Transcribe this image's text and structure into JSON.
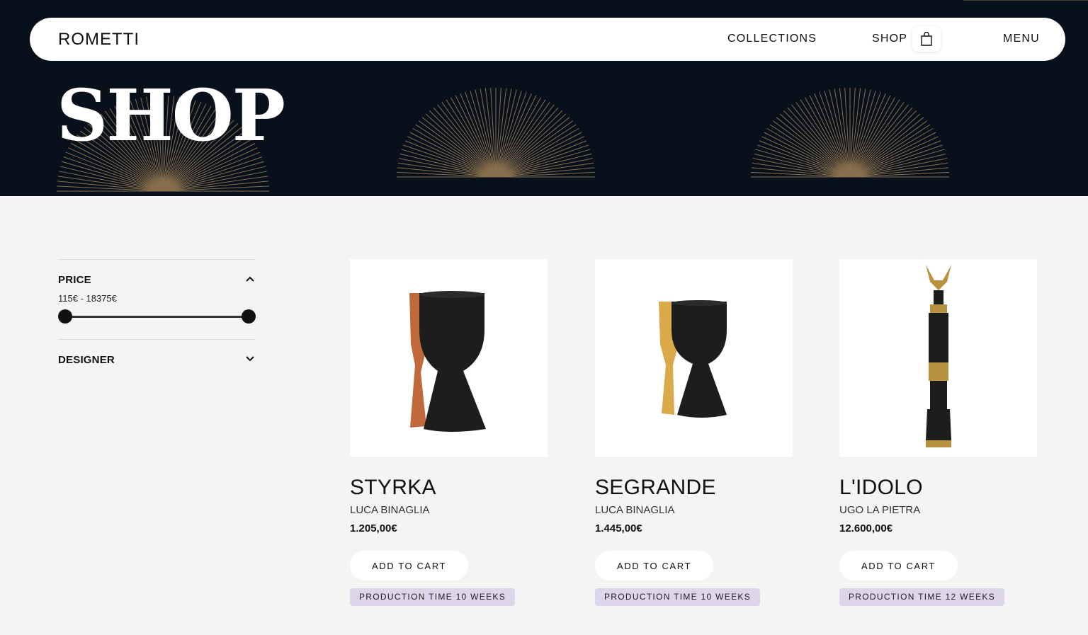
{
  "brand": "ROMETTI",
  "nav": {
    "collections": "COLLECTIONS",
    "shop": "SHOP",
    "menu": "MENU"
  },
  "hero": {
    "title": "SHOP"
  },
  "filters": {
    "price": {
      "label": "PRICE",
      "range": "115€ - 18375€",
      "min": 115,
      "max": 18375
    },
    "designer": {
      "label": "DESIGNER"
    }
  },
  "products": [
    {
      "name": "STYRKA",
      "designer": "LUCA BINAGLIA",
      "price": "1.205,00€",
      "cta": "ADD TO CART",
      "badge": "PRODUCTION TIME 10 WEEKS"
    },
    {
      "name": "SEGRANDE",
      "designer": "LUCA BINAGLIA",
      "price": "1.445,00€",
      "cta": "ADD TO CART",
      "badge": "PRODUCTION TIME 10 WEEKS"
    },
    {
      "name": "L'IDOLO",
      "designer": "UGO LA PIETRA",
      "price": "12.600,00€",
      "cta": "ADD TO CART",
      "badge": "PRODUCTION TIME 12 WEEKS"
    }
  ],
  "colors": {
    "hero_bg": "#07101b",
    "gold": "#a9875a",
    "badge_bg": "#ddd6ea",
    "page_bg": "#f4f4f4"
  },
  "icons": {
    "cart": "shopping-bag-icon",
    "price_toggle": "chevron-up-icon",
    "designer_toggle": "chevron-down-icon"
  }
}
